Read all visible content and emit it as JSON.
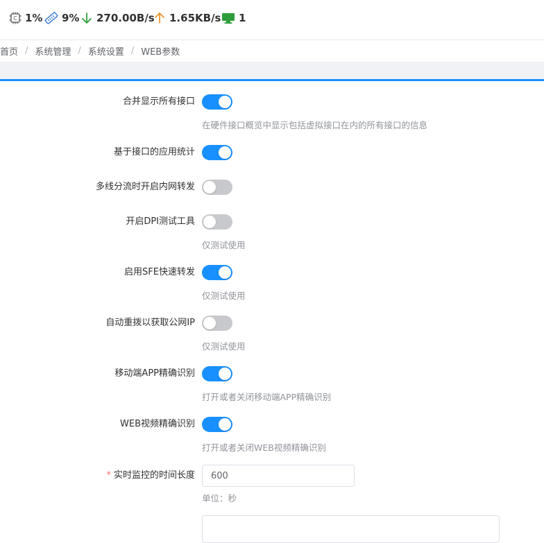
{
  "status": {
    "cpu": "1%",
    "memory": "9%",
    "download": "270.00B/s",
    "upload": "1.65KB/s",
    "terminals": "1",
    "colors": {
      "download": "#2e9d3a",
      "upload": "#f0962c",
      "terminal": "#2e9d3a"
    }
  },
  "breadcrumb": {
    "items": [
      "首页",
      "系统管理",
      "系统设置",
      "WEB参数"
    ],
    "separator": "/"
  },
  "accent_color": "#1890ff",
  "settings": [
    {
      "label": "合并显示所有接口",
      "enabled": true,
      "hint": "在硬件接口概览中显示包括虚拟接口在内的所有接口的信息"
    },
    {
      "label": "基于接口的应用统计",
      "enabled": true,
      "hint": ""
    },
    {
      "label": "多线分流时开启内网转发",
      "enabled": false,
      "hint": ""
    },
    {
      "label": "开启DPI测试工具",
      "enabled": false,
      "hint": "仅测试使用"
    },
    {
      "label": "启用SFE快速转发",
      "enabled": true,
      "hint": "仅测试使用"
    },
    {
      "label": "自动重拨以获取公网IP",
      "enabled": false,
      "hint": "仅测试使用"
    },
    {
      "label": "移动端APP精确识别",
      "enabled": true,
      "hint": "打开或者关闭移动端APP精确识别"
    },
    {
      "label": "WEB视频精确识别",
      "enabled": true,
      "hint": "打开或者关闭WEB视频精确识别"
    }
  ],
  "monitor": {
    "required_mark": "*",
    "label": "实时监控的时间长度",
    "value": "600",
    "hint": "单位：秒"
  }
}
